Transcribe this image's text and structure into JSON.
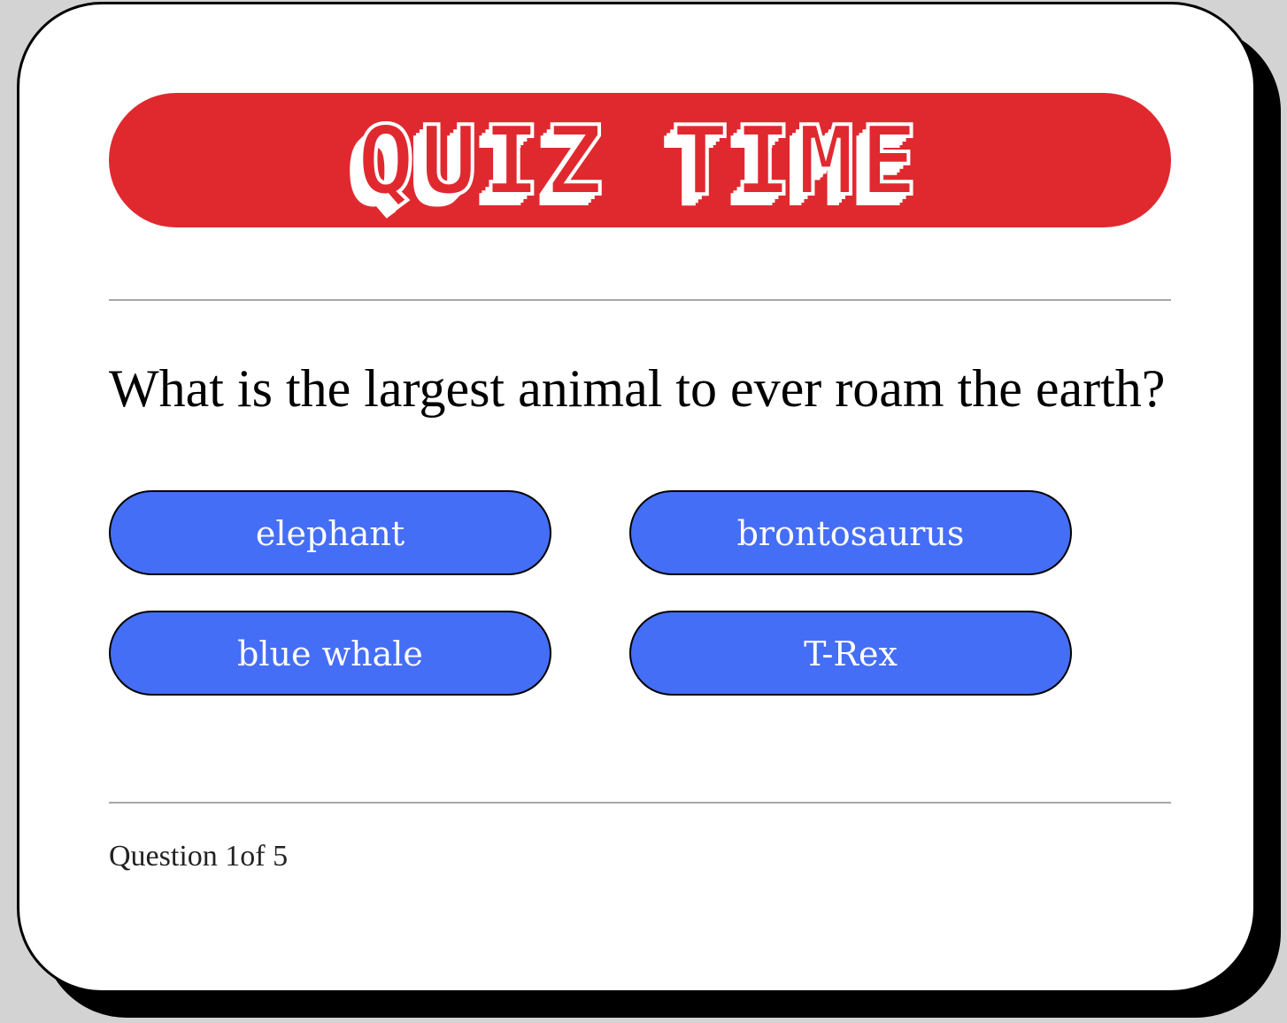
{
  "header": {
    "title": "QUIZ TIME",
    "banner_color": "#e0292f"
  },
  "quiz": {
    "question": "What is the largest animal to ever roam the earth?",
    "answers": [
      {
        "label": "elephant"
      },
      {
        "label": "brontosaurus"
      },
      {
        "label": "blue whale"
      },
      {
        "label": "T-Rex"
      }
    ],
    "answer_button_color": "#456ef6"
  },
  "footer": {
    "progress_text": "Question 1of 5",
    "current_question": 1,
    "total_questions": 5
  }
}
